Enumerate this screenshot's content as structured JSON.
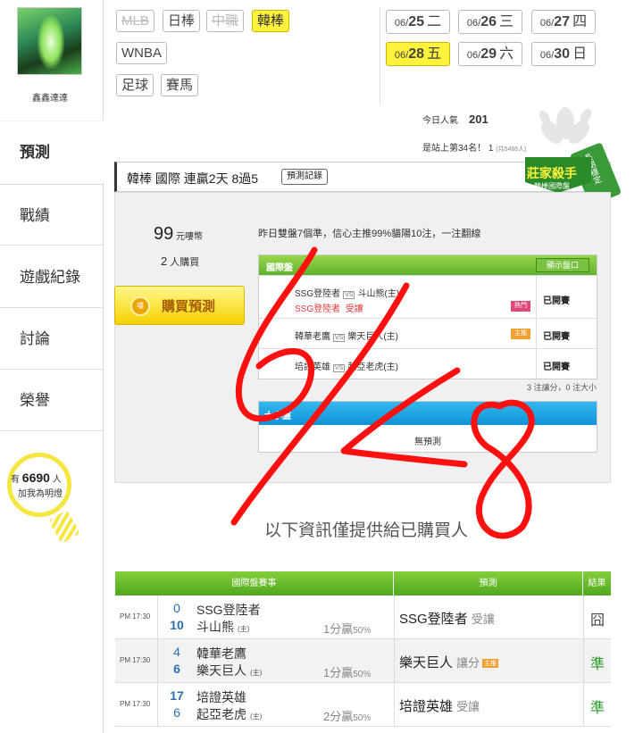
{
  "sidebar": {
    "username": "鑫鑫達達",
    "items": [
      {
        "label": "預測"
      },
      {
        "label": "戰績"
      },
      {
        "label": "遊戲紀錄"
      },
      {
        "label": "討論"
      },
      {
        "label": "榮譽"
      }
    ],
    "fans": {
      "prefix": "有",
      "count": "6690",
      "unit": "人",
      "caption": "加我為明燈"
    }
  },
  "filters": {
    "leagues": [
      {
        "label": "MLB",
        "state": "disabled"
      },
      {
        "label": "日棒",
        "state": "normal"
      },
      {
        "label": "中職",
        "state": "disabled"
      },
      {
        "label": "韓棒",
        "state": "selected"
      },
      {
        "label": "WNBA",
        "state": "normal"
      },
      {
        "label": "足球",
        "state": "normal"
      },
      {
        "label": "賽馬",
        "state": "normal"
      }
    ],
    "dates": [
      {
        "month": "06/",
        "day": "25",
        "weekday": "二"
      },
      {
        "month": "06/",
        "day": "26",
        "weekday": "三"
      },
      {
        "month": "06/",
        "day": "27",
        "weekday": "四"
      },
      {
        "month": "06/",
        "day": "28",
        "weekday": "五",
        "selected": true
      },
      {
        "month": "06/",
        "day": "29",
        "weekday": "六"
      },
      {
        "month": "06/",
        "day": "30",
        "weekday": "日"
      }
    ]
  },
  "popularity": {
    "today_label": "今日人氣",
    "today_value": "201",
    "rank_text": "是站上第34名！",
    "rank_sub": "1",
    "rank_total": "(共5466人)"
  },
  "panel": {
    "title": "韓棒 國際 連贏2天 8過5",
    "record_button": "預測記錄",
    "badge_title": "莊家殺手",
    "badge_sub": "韓棒國際盤",
    "badge_ribbon": "長期穩定",
    "price_value": "99",
    "price_unit": "元嘍幣",
    "buyers_count": "2",
    "buyers_unit": "人購買",
    "buy_button": "購買預測",
    "buy_coin": "嘍",
    "summary": "昨日雙盤7個準，信心主推99%貓陽10注，一注翻線",
    "intl_header": "國際盤",
    "show_button": "顯示盤口",
    "intl_rows": [
      {
        "home": "SSG登陸者",
        "away": "斗山熊(主)",
        "pick": "SSG登陸者",
        "pick_type": "受讓",
        "tag": "熱門",
        "status": "已開賽"
      },
      {
        "home": "韓華老鷹",
        "away": "樂天巨人(主)",
        "tag": "主推",
        "status": "已開賽"
      },
      {
        "home": "培證英雄",
        "away": "起亞老虎(主)",
        "status": "已開賽"
      }
    ],
    "vs_label": "VS",
    "footnote": "3 注讓分，0 注大小",
    "total_header": "大小盤",
    "total_none": "無預測"
  },
  "notice": "以下資訊僅提供給已購買人",
  "results": {
    "headers": [
      "國際盤賽事",
      "預測",
      "結果"
    ],
    "rows": [
      {
        "time": "PM 17:30",
        "score1": "0",
        "team1": "SSG登陸者",
        "score2": "10",
        "team2": "斗山熊",
        "home_mark": "(主)",
        "odds": "1分贏",
        "odds_pct": "50%",
        "pick": "SSG登陸者",
        "pick_type": "受讓",
        "pick_tag": "",
        "result": "囧",
        "win": false
      },
      {
        "time": "PM 17:30",
        "score1": "4",
        "team1": "韓華老鷹",
        "score2": "6",
        "team2": "樂天巨人",
        "home_mark": "(主)",
        "odds": "1分贏",
        "odds_pct": "50%",
        "pick": "樂天巨人",
        "pick_type": "讓分",
        "pick_tag": "主推",
        "result": "準",
        "win": true
      },
      {
        "time": "PM 17:30",
        "score1": "17",
        "team1": "培證英雄",
        "score2": "6",
        "team2": "起亞老虎",
        "home_mark": "(主)",
        "odds": "2分贏",
        "odds_pct": "50%",
        "pick": "培證英雄",
        "pick_type": "受讓",
        "pick_tag": "",
        "result": "準",
        "win": true
      }
    ]
  },
  "colors": {
    "accent_yellow": "#fff23c",
    "green": "#5fb22e",
    "blue": "#0f93d6",
    "scribble_red": "#ff1010"
  }
}
